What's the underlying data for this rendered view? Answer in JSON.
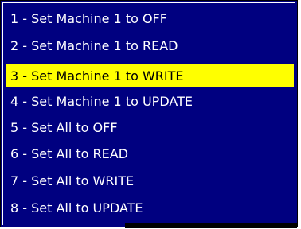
{
  "menu": {
    "items": [
      {
        "label": "1 - Set Machine 1 to OFF",
        "selected": false
      },
      {
        "label": "2 - Set Machine 1 to READ",
        "selected": false
      },
      {
        "label": "3 - Set Machine 1 to WRITE",
        "selected": true
      },
      {
        "label": "4 - Set Machine 1 to UPDATE",
        "selected": false
      },
      {
        "label": "5 - Set All to OFF",
        "selected": false
      },
      {
        "label": "6 - Set All to READ",
        "selected": false
      },
      {
        "label": "7 - Set All to WRITE",
        "selected": false
      },
      {
        "label": "8 - Set All to UPDATE",
        "selected": false
      }
    ]
  },
  "colors": {
    "background": "#000080",
    "text": "#ffffff",
    "highlight": "#ffff00",
    "highlight_text": "#000000"
  }
}
